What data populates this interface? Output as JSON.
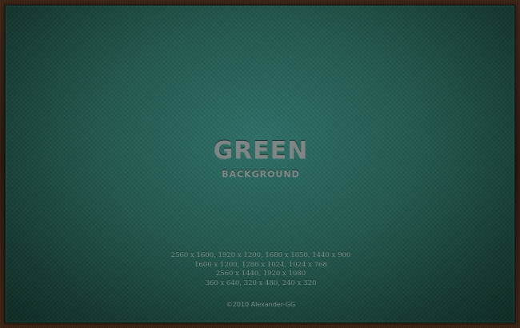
{
  "wallpaper": {
    "title": "GREEN",
    "subtitle": "BACKGROUND",
    "resolutions": [
      "2560 x 1600, 1920 x 1200, 1680 x 1050, 1440 x 900",
      "1600 x 1200, 1280 x 1024, 1024 x 768",
      "2560 x 1440, 1920 x 1080",
      "360 x 640, 320 x 480, 240 x 320"
    ],
    "copyright": "©2010 Alexander-GG"
  },
  "colors": {
    "background_teal": "#24594f",
    "frame_brown": "#3b2416",
    "text_gray": "#7d8684"
  }
}
